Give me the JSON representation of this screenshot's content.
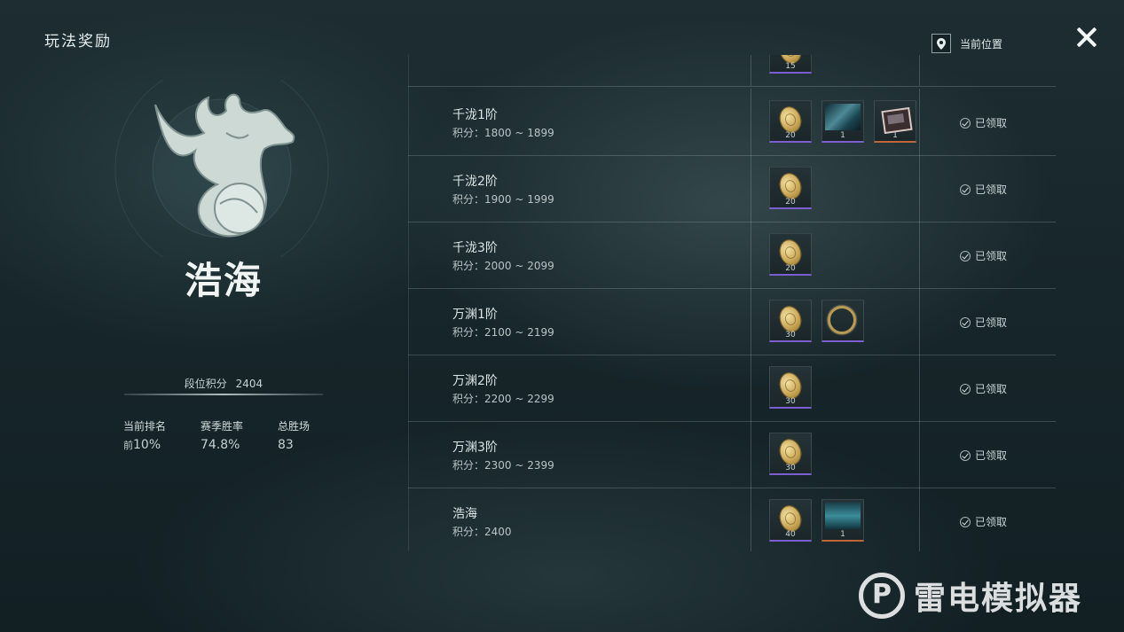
{
  "header": {
    "title": "玩法奖励",
    "location_label": "当前位置",
    "location_icon": "location-pin-icon",
    "close_icon": "close-icon"
  },
  "rank": {
    "name": "浩海",
    "score_label": "段位积分",
    "score_value": "2404",
    "stats": [
      {
        "label": "当前排名",
        "prefix": "前",
        "value": "10%"
      },
      {
        "label": "赛季胜率",
        "prefix": "",
        "value": "74.8%"
      },
      {
        "label": "总胜场",
        "prefix": "",
        "value": "83"
      }
    ]
  },
  "tiers": [
    {
      "name": "千泷1阶",
      "range": "积分：1800 ~ 1899",
      "status": "已领取",
      "rewards": [
        {
          "icon": "coin-icon",
          "count": "20",
          "quality": "purple"
        },
        {
          "icon": "scene-card-icon",
          "count": "1",
          "quality": "purple"
        },
        {
          "icon": "frame-card-icon",
          "count": "1",
          "quality": "orange"
        }
      ]
    },
    {
      "name": "千泷2阶",
      "range": "积分：1900 ~ 1999",
      "status": "已领取",
      "rewards": [
        {
          "icon": "coin-icon",
          "count": "20",
          "quality": "purple"
        }
      ]
    },
    {
      "name": "千泷3阶",
      "range": "积分：2000 ~ 2099",
      "status": "已领取",
      "rewards": [
        {
          "icon": "coin-icon",
          "count": "20",
          "quality": "purple"
        }
      ]
    },
    {
      "name": "万渊1阶",
      "range": "积分：2100 ~ 2199",
      "status": "已领取",
      "rewards": [
        {
          "icon": "coin-icon",
          "count": "30",
          "quality": "purple"
        },
        {
          "icon": "ring-icon",
          "count": "",
          "quality": "purple"
        }
      ]
    },
    {
      "name": "万渊2阶",
      "range": "积分：2200 ~ 2299",
      "status": "已领取",
      "rewards": [
        {
          "icon": "coin-icon",
          "count": "30",
          "quality": "purple"
        }
      ]
    },
    {
      "name": "万渊3阶",
      "range": "积分：2300 ~ 2399",
      "status": "已领取",
      "rewards": [
        {
          "icon": "coin-icon",
          "count": "30",
          "quality": "purple"
        }
      ]
    },
    {
      "name": "浩海",
      "range": "积分：2400",
      "status": "已领取",
      "rewards": [
        {
          "icon": "coin-icon",
          "count": "40",
          "quality": "purple"
        },
        {
          "icon": "scene-card-icon",
          "count": "1",
          "quality": "orange"
        }
      ]
    }
  ],
  "partial_top_reward_count": "15",
  "watermark": "雷电模拟器"
}
